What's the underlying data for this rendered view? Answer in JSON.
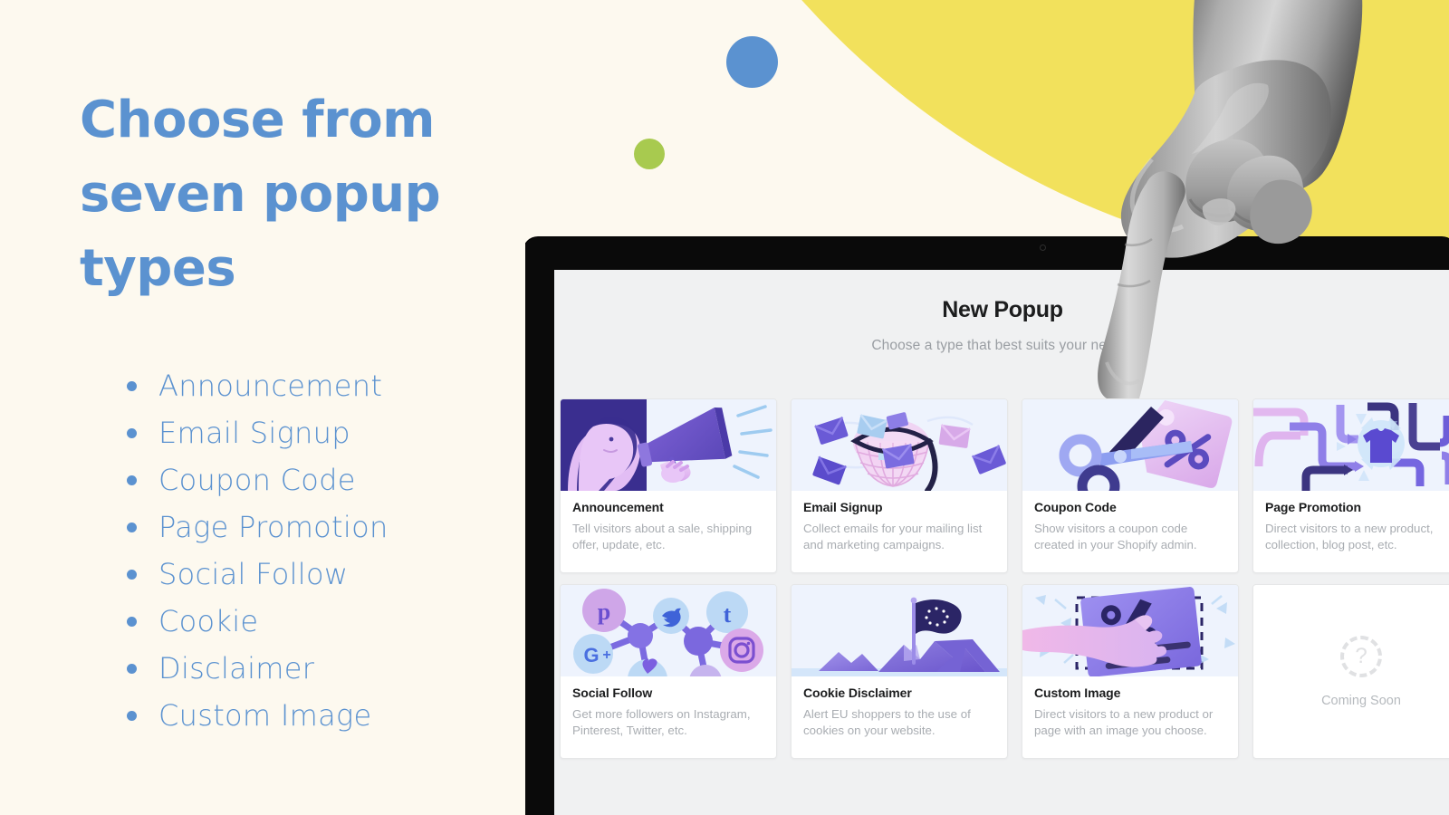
{
  "theme": {
    "bg_cream": "#fdf9ef",
    "accent_blue": "#5b92d0",
    "accent_yellow": "#f2e15c",
    "accent_green": "#a8ca4f",
    "screen_bg": "#f0f1f2",
    "card_bg": "#ffffff",
    "title_color": "#1c1d1e",
    "muted_color": "#a9adb2"
  },
  "promo": {
    "headline": "Choose from seven popup types",
    "type_list": [
      {
        "label": "Announcement"
      },
      {
        "label": "Email Signup"
      },
      {
        "label": "Coupon Code"
      },
      {
        "label": "Page Promotion"
      },
      {
        "label": "Social Follow"
      },
      {
        "label": "Cookie"
      },
      {
        "label": "Disclaimer"
      },
      {
        "label": "Custom Image"
      }
    ]
  },
  "modal": {
    "title": "New Popup",
    "subtitle": "Choose a type that best suits your needs.",
    "cards": [
      {
        "icon": "megaphone-illustration",
        "title": "Announcement",
        "desc": "Tell visitors about a sale, shipping offer, update, etc."
      },
      {
        "icon": "net-catching-envelopes-illustration",
        "title": "Email Signup",
        "desc": "Collect emails for your mailing list and marketing campaigns."
      },
      {
        "icon": "scissors-price-tag-illustration",
        "title": "Coupon Code",
        "desc": "Show visitors a coupon code created in your Shopify admin."
      },
      {
        "icon": "arrow-pipes-tshirt-illustration",
        "title": "Page Promotion",
        "desc": "Direct visitors to a new product, collection, blog post, etc."
      },
      {
        "icon": "social-network-graph-illustration",
        "title": "Social Follow",
        "desc": "Get more followers on Instagram, Pinterest, Twitter, etc."
      },
      {
        "icon": "eu-flag-mountain-illustration",
        "title": "Cookie Disclaimer",
        "desc": "Alert EU shoppers to the use of cookies on your website."
      },
      {
        "icon": "hand-placing-poster-illustration",
        "title": "Custom Image",
        "desc": "Direct visitors to a new product or page with an image you choose."
      }
    ],
    "coming_soon": {
      "icon": "question-mark-dashed-circle-icon",
      "glyph": "?",
      "label": "Coming Soon"
    }
  },
  "decor": {
    "blue_circle": "blue-circle-decoration",
    "green_circle": "green-circle-decoration",
    "yellow_blob": "yellow-curve-decoration",
    "hand": "pointing-hand-photo",
    "webcam": "laptop-webcam"
  }
}
